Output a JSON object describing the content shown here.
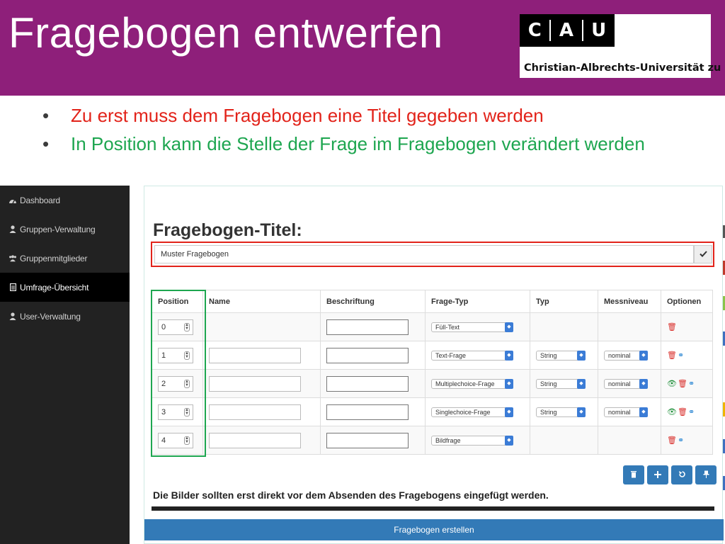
{
  "slide": {
    "title": "Fragebogen entwerfen",
    "logo": {
      "letters": [
        "C",
        "A",
        "U"
      ],
      "institution": "Christian-Albrechts-Universität zu Kiel"
    },
    "bullets": [
      {
        "text": "Zu erst muss dem Fragebogen eine Titel gegeben werden",
        "color": "#e2231a"
      },
      {
        "text": "In Position kann die Stelle der Frage im Fragebogen verändert werden",
        "color": "#1ea650"
      }
    ],
    "bullet_symbol": "•"
  },
  "sidebar": {
    "items": [
      {
        "label": "Dashboard",
        "icon": "dashboard-icon",
        "active": false
      },
      {
        "label": "Gruppen-Verwaltung",
        "icon": "user-icon",
        "active": false
      },
      {
        "label": "Gruppenmitglieder",
        "icon": "users-icon",
        "active": false
      },
      {
        "label": "Umfrage-Übersicht",
        "icon": "document-icon",
        "active": true
      },
      {
        "label": "User-Verwaltung",
        "icon": "user-icon",
        "active": false
      }
    ]
  },
  "form": {
    "heading": "Fragebogen-Titel:",
    "title_value": "Muster Fragebogen",
    "confirm_icon": "checkmark-icon"
  },
  "table": {
    "headers": [
      "Position",
      "Name",
      "Beschriftung",
      "Frage-Typ",
      "Typ",
      "Messniveau",
      "Optionen"
    ],
    "rows": [
      {
        "position": "0",
        "name": "",
        "beschriftung": "",
        "frage_typ": "Füll-Text",
        "typ": "",
        "messniveau": "",
        "options": [
          "trash-icon"
        ]
      },
      {
        "position": "1",
        "name": "",
        "beschriftung": "",
        "frage_typ": "Text-Frage",
        "typ": "String",
        "messniveau": "nominal",
        "options": [
          "trash-icon",
          "toggle-icon"
        ]
      },
      {
        "position": "2",
        "name": "",
        "beschriftung": "",
        "frage_typ": "Multiplechoice-Frage",
        "typ": "String",
        "messniveau": "nominal",
        "options": [
          "eye-icon",
          "trash-icon",
          "toggle-icon"
        ]
      },
      {
        "position": "3",
        "name": "",
        "beschriftung": "",
        "frage_typ": "Singlechoice-Frage",
        "typ": "String",
        "messniveau": "nominal",
        "options": [
          "eye-icon",
          "trash-icon",
          "toggle-icon"
        ]
      },
      {
        "position": "4",
        "name": "",
        "beschriftung": "",
        "frage_typ": "Bildfrage",
        "typ": "",
        "messniveau": "",
        "options": [
          "trash-icon",
          "toggle-icon"
        ]
      }
    ]
  },
  "actions": {
    "buttons": [
      {
        "icon": "trash-icon"
      },
      {
        "icon": "plus-icon"
      },
      {
        "icon": "refresh-icon"
      },
      {
        "icon": "pin-icon"
      }
    ]
  },
  "note": "Die Bilder sollten erst direkt vor dem Absenden des Fragebogens eingefügt werden.",
  "submit_label": "Fragebogen erstellen",
  "colors": {
    "title_band": "#8e1f7a",
    "primary": "#337ab7",
    "highlight_red": "#e2231a",
    "highlight_green": "#1ea650",
    "sidebar": "#222222"
  }
}
